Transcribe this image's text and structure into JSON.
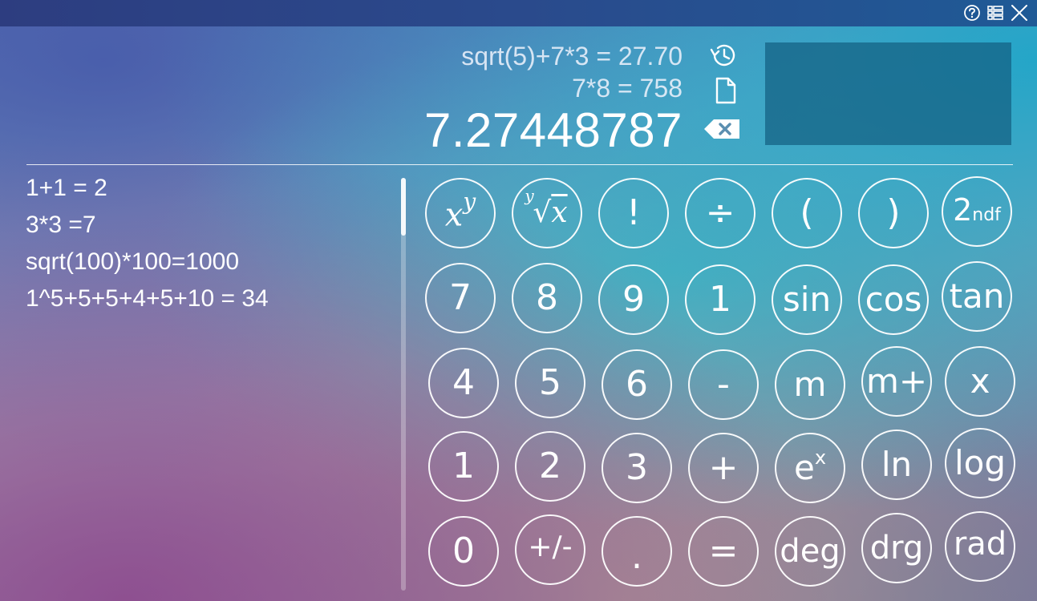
{
  "history": {
    "previous_1": "sqrt(5)+7*3 = 27.70",
    "previous_2": "7*8 = 758"
  },
  "display": {
    "result": "7.27448787"
  },
  "tape": [
    "1+1 = 2",
    "3*3 =7",
    "sqrt(100)*100=1000",
    "1^5+5+5+4+5+10 = 34"
  ],
  "keypad": {
    "rows": [
      [
        "x^y",
        "y√x",
        "!",
        "÷",
        "(",
        ")",
        "2ndf"
      ],
      [
        "7",
        "8",
        "9",
        "1",
        "sin",
        "cos",
        "tan"
      ],
      [
        "4",
        "5",
        "6",
        "-",
        "m",
        "m+",
        "x"
      ],
      [
        "1",
        "2",
        "3",
        "+",
        "eˣ",
        "ln",
        "log"
      ],
      [
        "0",
        "+/-",
        ".",
        "=",
        "deg",
        "drg",
        "rad"
      ]
    ],
    "power_base": "x",
    "power_exp": "y",
    "root_index": "y",
    "root_radicand": "x",
    "second_main": "2",
    "second_sub": "ndf",
    "exp_base": "e",
    "exp_power": "x"
  },
  "icons": {
    "help": "help-icon",
    "menu": "list-icon",
    "close": "close-icon",
    "history": "history-icon",
    "copy": "document-icon",
    "backspace": "backspace-icon"
  },
  "colors": {
    "titlebar": "#2a4a8c",
    "memory_panel": "#1f6f8f",
    "text": "#ffffff"
  }
}
